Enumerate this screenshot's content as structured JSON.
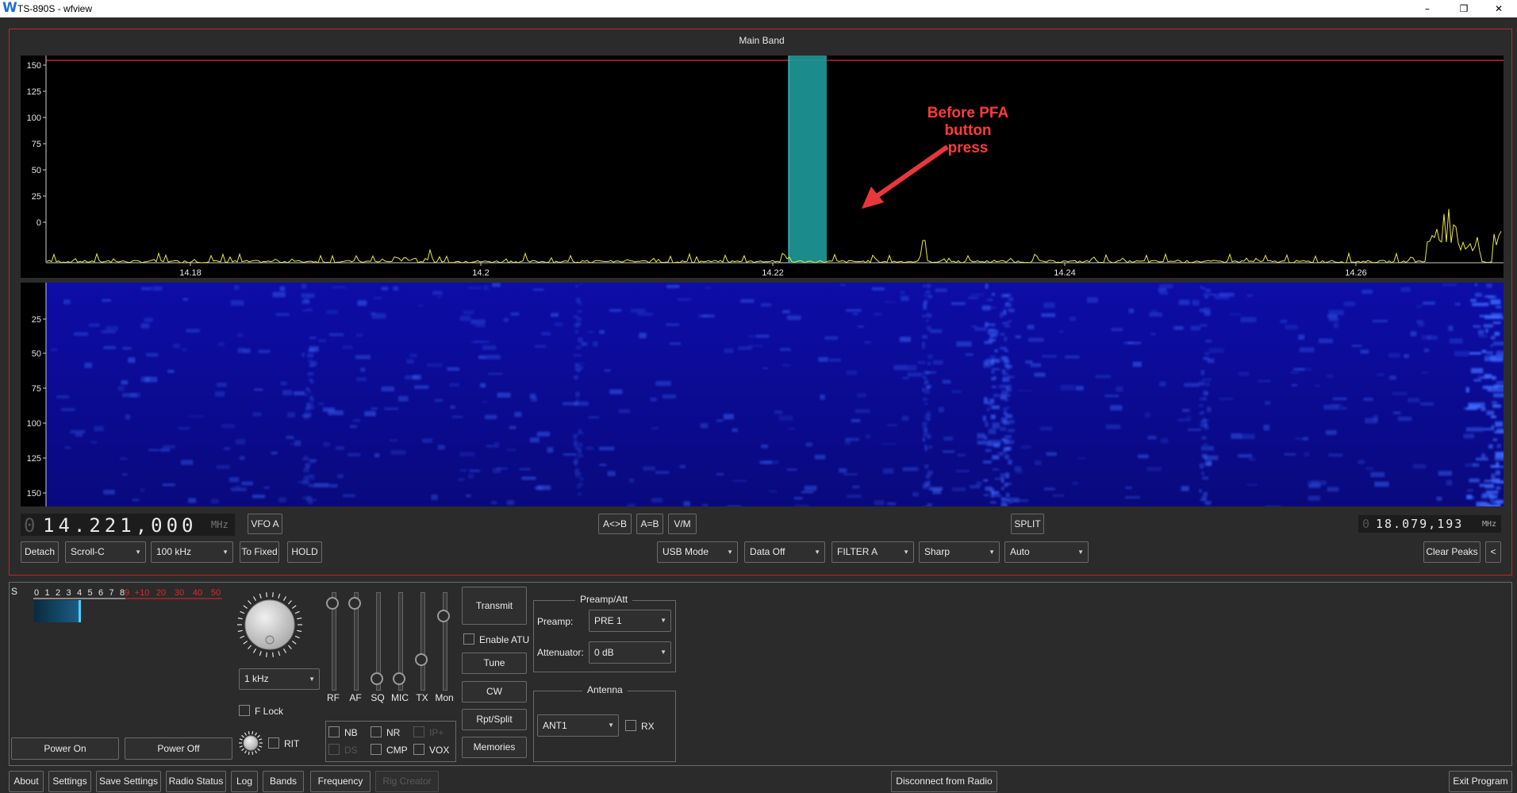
{
  "window": {
    "title": "TS-890S - wfview",
    "logo": "W",
    "controls": {
      "minimize": "–",
      "maximize": "❐",
      "close": "✕"
    }
  },
  "main_band": {
    "title": "Main Band",
    "spectrum": {
      "y_ticks": [
        "150",
        "125",
        "100",
        "75",
        "50",
        "25",
        "0"
      ],
      "x_ticks": [
        "14.18",
        "14.2",
        "14.22",
        "14.24",
        "14.26"
      ],
      "colors": {
        "background": "#000000",
        "trace": "#e8e83a",
        "passband": "#1e9a9a",
        "ref_line": "#c0282d"
      }
    },
    "waterfall": {
      "y_ticks": [
        "25",
        "50",
        "75",
        "100",
        "125",
        "150"
      ],
      "colors": {
        "background": "#0b0b9e",
        "signal": "#3d8bff"
      }
    },
    "annotation": {
      "lines": [
        "Before PFA",
        "button",
        "press"
      ],
      "color": "#ff3b3b"
    }
  },
  "freq_row": {
    "main_freq": {
      "lead": "0",
      "digits": "14.221,000",
      "unit": "MHz"
    },
    "vfo_button": "VFO A",
    "ab_swap": "A<>B",
    "a_eq_b": "A=B",
    "vm": "V/M",
    "split": "SPLIT",
    "sub_freq": {
      "lead": "0",
      "digits": "18.079,193",
      "unit": "MHz"
    }
  },
  "control_row": {
    "detach": "Detach",
    "scroll_mode": "Scroll-C",
    "span": "100 kHz",
    "to_fixed": "To Fixed",
    "hold": "HOLD",
    "mode": "USB Mode",
    "data": "Data Off",
    "filter": "FILTER A",
    "filter_shape": "Sharp",
    "agc": "Auto",
    "clear_peaks": "Clear Peaks",
    "collapse": "<"
  },
  "meter": {
    "label": "S",
    "scale_white": [
      "0",
      "1",
      "2",
      "3",
      "4",
      "5",
      "6",
      "7",
      "8"
    ],
    "scale_red": [
      "9",
      "+10",
      "20",
      "30",
      "40",
      "50"
    ]
  },
  "tuning": {
    "step": "1 kHz",
    "f_lock": "F Lock",
    "rit": "RIT"
  },
  "sliders": [
    {
      "label": "RF",
      "level": 0.95
    },
    {
      "label": "AF",
      "level": 0.95
    },
    {
      "label": "SQ",
      "level": 0.08
    },
    {
      "label": "MIC",
      "level": 0.08
    },
    {
      "label": "TX",
      "level": 0.3
    },
    {
      "label": "Mon",
      "level": 0.8
    }
  ],
  "dsp": {
    "nb": "NB",
    "nr": "NR",
    "ip": "IP+",
    "ds": "DS",
    "cmp": "CMP",
    "vox": "VOX"
  },
  "tx_buttons": {
    "transmit": "Transmit",
    "enable_atu": "Enable ATU",
    "tune": "Tune",
    "cw": "CW",
    "rpt_split": "Rpt/Split",
    "memories": "Memories"
  },
  "preamp_att": {
    "title": "Preamp/Att",
    "preamp_label": "Preamp:",
    "preamp_value": "PRE 1",
    "att_label": "Attenuator:",
    "att_value": "0 dB"
  },
  "antenna": {
    "title": "Antenna",
    "value": "ANT1",
    "rx": "RX"
  },
  "power": {
    "on": "Power On",
    "off": "Power Off"
  },
  "bottom_bar": {
    "about": "About",
    "settings": "Settings",
    "save_settings": "Save Settings",
    "radio_status": "Radio Status",
    "log": "Log",
    "bands": "Bands",
    "frequency": "Frequency",
    "rig_creator": "Rig Creator",
    "disconnect": "Disconnect from Radio",
    "exit": "Exit Program"
  }
}
